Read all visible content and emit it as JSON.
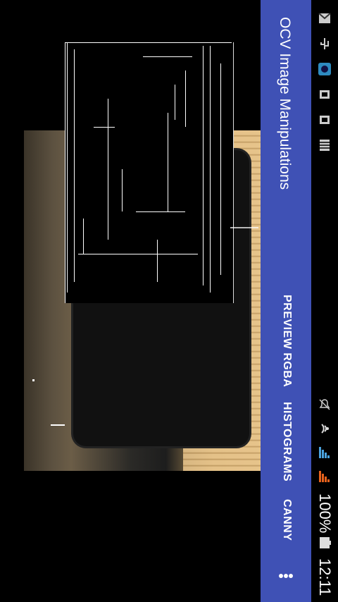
{
  "app_bar": {
    "title": "OCV Image Manipulations",
    "menu_items": [
      "PREVIEW RGBA",
      "HISTOGRAMS",
      "CANNY"
    ],
    "overflow_icon": "more-vert-icon",
    "color": "#3f51b5"
  },
  "status_bar": {
    "battery": "100%",
    "time": "12:11",
    "left_icons": [
      "gmail-icon",
      "usb-icon",
      "app-icon",
      "cast-icon",
      "cast-icon",
      "storage-icon"
    ],
    "right_icons": [
      "mute-icon",
      "wifi-icon",
      "signal-icon",
      "signal-icon",
      "battery-icon"
    ]
  },
  "camera": {
    "mode": "canny-edge-preview"
  }
}
